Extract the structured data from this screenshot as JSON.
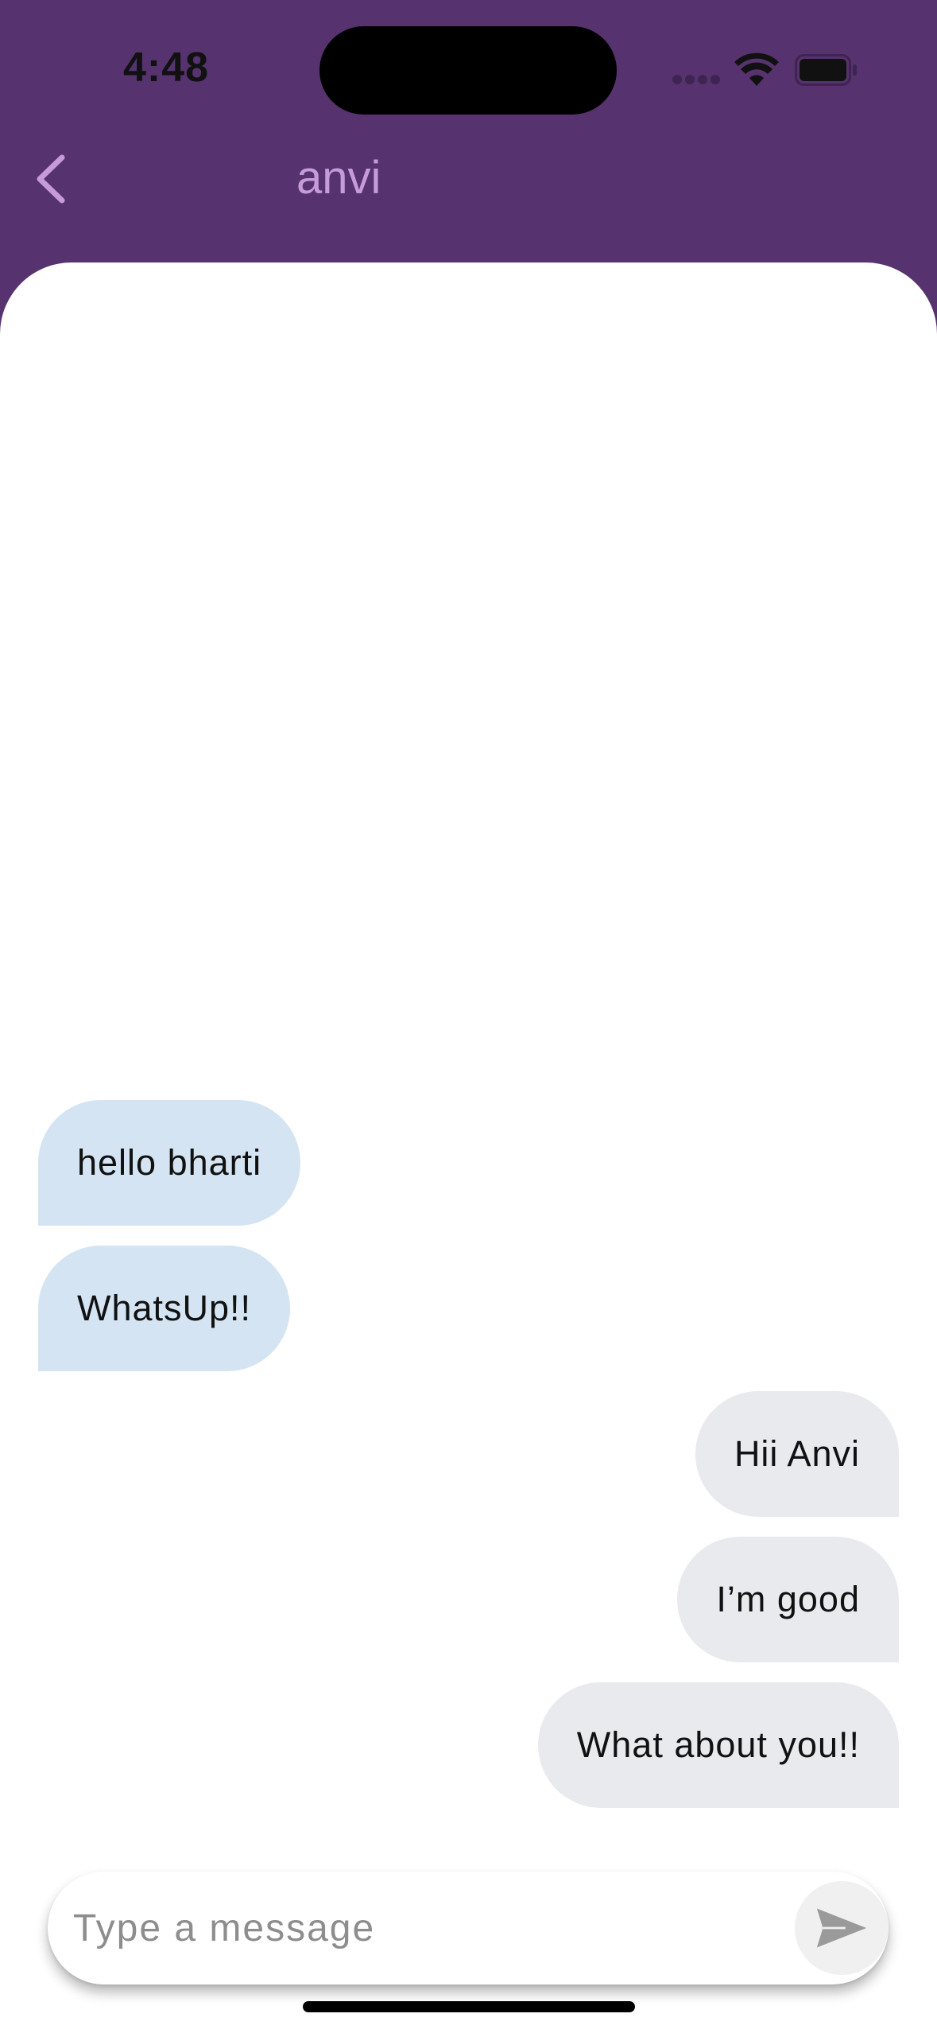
{
  "status_bar": {
    "time": "4:48"
  },
  "header": {
    "title": "anvi",
    "back_icon": "chevron-left-icon"
  },
  "messages": [
    {
      "text": "hello bharti",
      "direction": "received"
    },
    {
      "text": "WhatsUp!!",
      "direction": "received"
    },
    {
      "text": "Hii Anvi",
      "direction": "sent"
    },
    {
      "text": "I’m good",
      "direction": "sent"
    },
    {
      "text": "What about you!!",
      "direction": "sent"
    }
  ],
  "composer": {
    "placeholder": "Type a message",
    "value": "",
    "send_icon": "send-icon"
  },
  "colors": {
    "header_background": "#56326e",
    "title_color": "#c79bd7",
    "received_bubble": "#d4e4f2",
    "sent_bubble": "#e9eaee"
  }
}
